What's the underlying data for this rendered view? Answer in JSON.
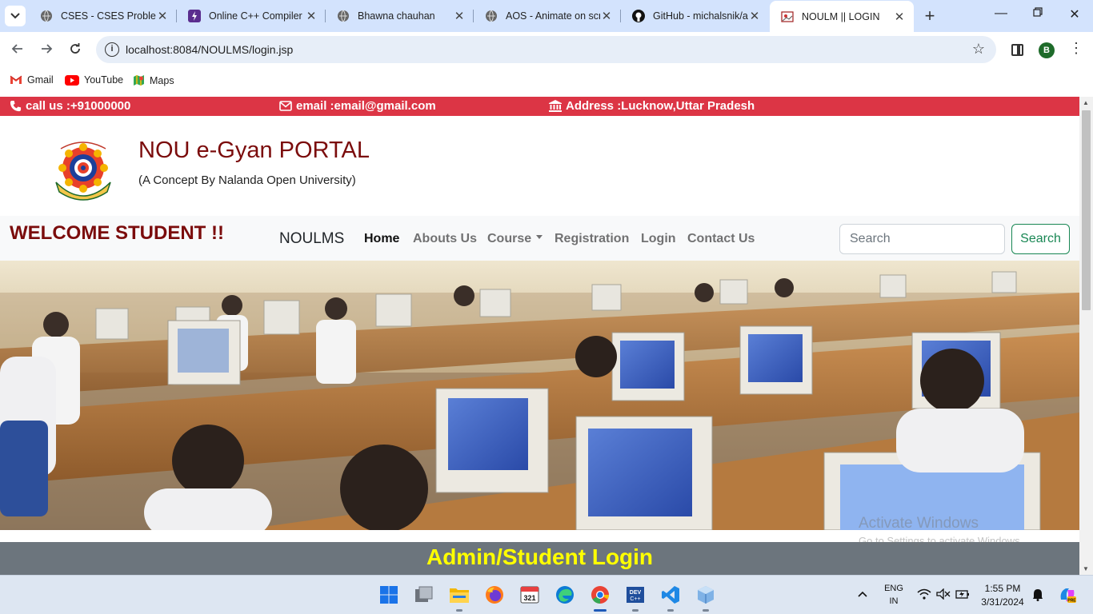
{
  "browser": {
    "tabs": [
      {
        "title": "CSES - CSES Problem Set",
        "favicon": "globe-icon"
      },
      {
        "title": "Online C++ Compiler",
        "favicon": "compiler-icon"
      },
      {
        "title": "Bhawna chauhan",
        "favicon": "globe-icon"
      },
      {
        "title": "AOS - Animate on scroll",
        "favicon": "globe-icon"
      },
      {
        "title": "GitHub - michalsnik/aos",
        "favicon": "github-icon"
      },
      {
        "title": "NOULM || LOGIN",
        "favicon": "page-icon"
      }
    ],
    "url": "localhost:8084/NOULMS/login.jsp",
    "profile_initial": "B",
    "bookmarks": [
      {
        "label": "Gmail",
        "icon": "gmail-icon"
      },
      {
        "label": "YouTube",
        "icon": "youtube-icon"
      },
      {
        "label": "Maps",
        "icon": "maps-icon"
      }
    ]
  },
  "page": {
    "contact": {
      "phone": "call us :+91000000",
      "email": "email :email@gmail.com",
      "address": "Address :Lucknow,Uttar Pradesh"
    },
    "title": "NOU e-Gyan PORTAL",
    "subtitle": "(A Concept By Nalanda Open University)",
    "welcome": "WELCOME STUDENT !!",
    "nav": {
      "brand": "NOULMS",
      "links": [
        "Home",
        "Abouts Us",
        "Course",
        "Registration",
        "Login",
        "Contact Us"
      ],
      "active": "Home"
    },
    "search": {
      "placeholder": "Search",
      "button": "Search"
    },
    "login_heading": "Admin/Student Login"
  },
  "watermark": {
    "line1": "Activate Windows",
    "line2": "Go to Settings to activate Windows."
  },
  "taskbar": {
    "apps": [
      "start-icon",
      "task-view-icon",
      "file-explorer-icon",
      "firefox-icon",
      "calendar-app-icon",
      "edge-icon",
      "chrome-icon",
      "dev-cpp-icon",
      "vscode-icon",
      "virtualbox-icon"
    ],
    "language": "ENG",
    "region": "IN",
    "time": "1:55 PM",
    "date": "3/31/2024"
  },
  "colors": {
    "topbar": "#dc3545",
    "title": "#7b0c0c",
    "login_bar": "#6c757d",
    "login_text": "#ffff00",
    "search_button": "#198754"
  }
}
